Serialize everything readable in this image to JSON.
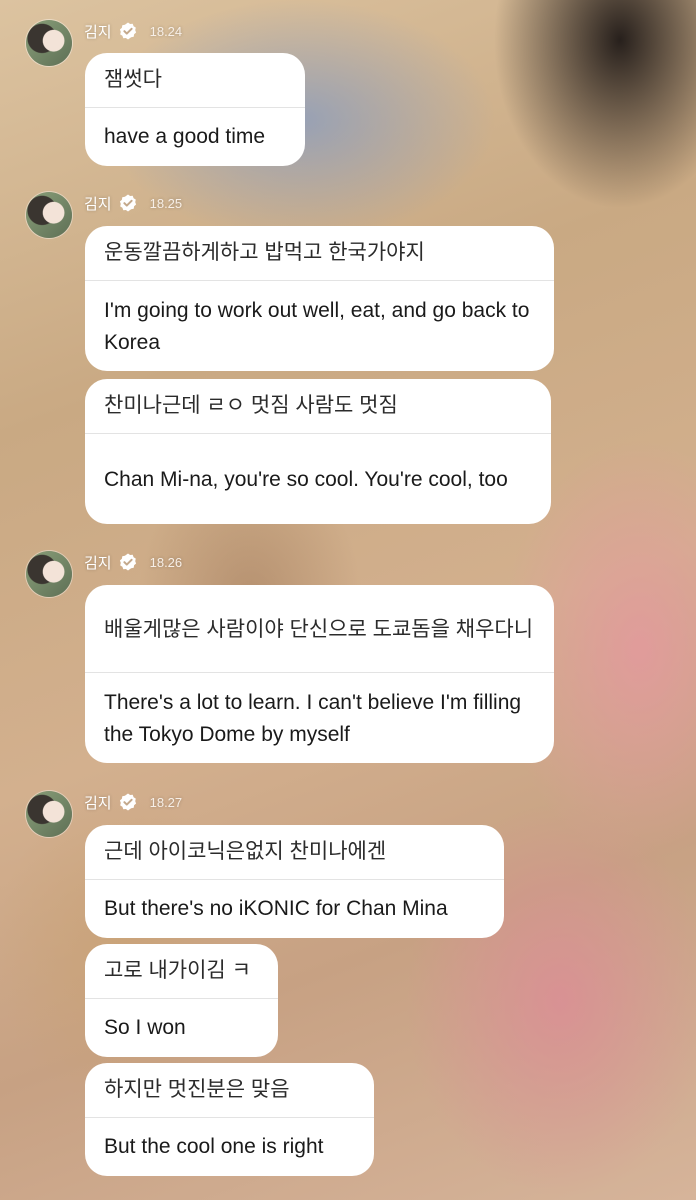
{
  "sender": {
    "name": "김지",
    "verified_icon": "verified-badge-icon"
  },
  "groups": [
    {
      "time": "18.24",
      "messages": [
        {
          "ko": "잼썻다",
          "en": "have a good time"
        }
      ]
    },
    {
      "time": "18.25",
      "messages": [
        {
          "ko": "운동깔끔하게하고 밥먹고 한국가야지",
          "en": "I'm going to work out well, eat, and go back to Korea"
        },
        {
          "ko": "찬미나근데 ㄹㅇ 멋짐 사람도 멋짐",
          "en": "Chan Mi-na, you're so cool. You're cool, too"
        }
      ]
    },
    {
      "time": "18.26",
      "messages": [
        {
          "ko": "배울게많은 사람이야 단신으로 도쿄돔을 채우다니",
          "en": "There's a lot to learn. I can't believe I'm filling the Tokyo Dome by myself"
        }
      ]
    },
    {
      "time": "18.27",
      "messages": [
        {
          "ko": "근데 아이코닉은없지 찬미나에겐",
          "en": "But there's no iKONIC for Chan Mina"
        },
        {
          "ko": "고로 내가이김 ㅋ",
          "en": "So I won"
        },
        {
          "ko": "하지만 멋진분은 맞음",
          "en": "But the cool one is right"
        }
      ]
    }
  ]
}
